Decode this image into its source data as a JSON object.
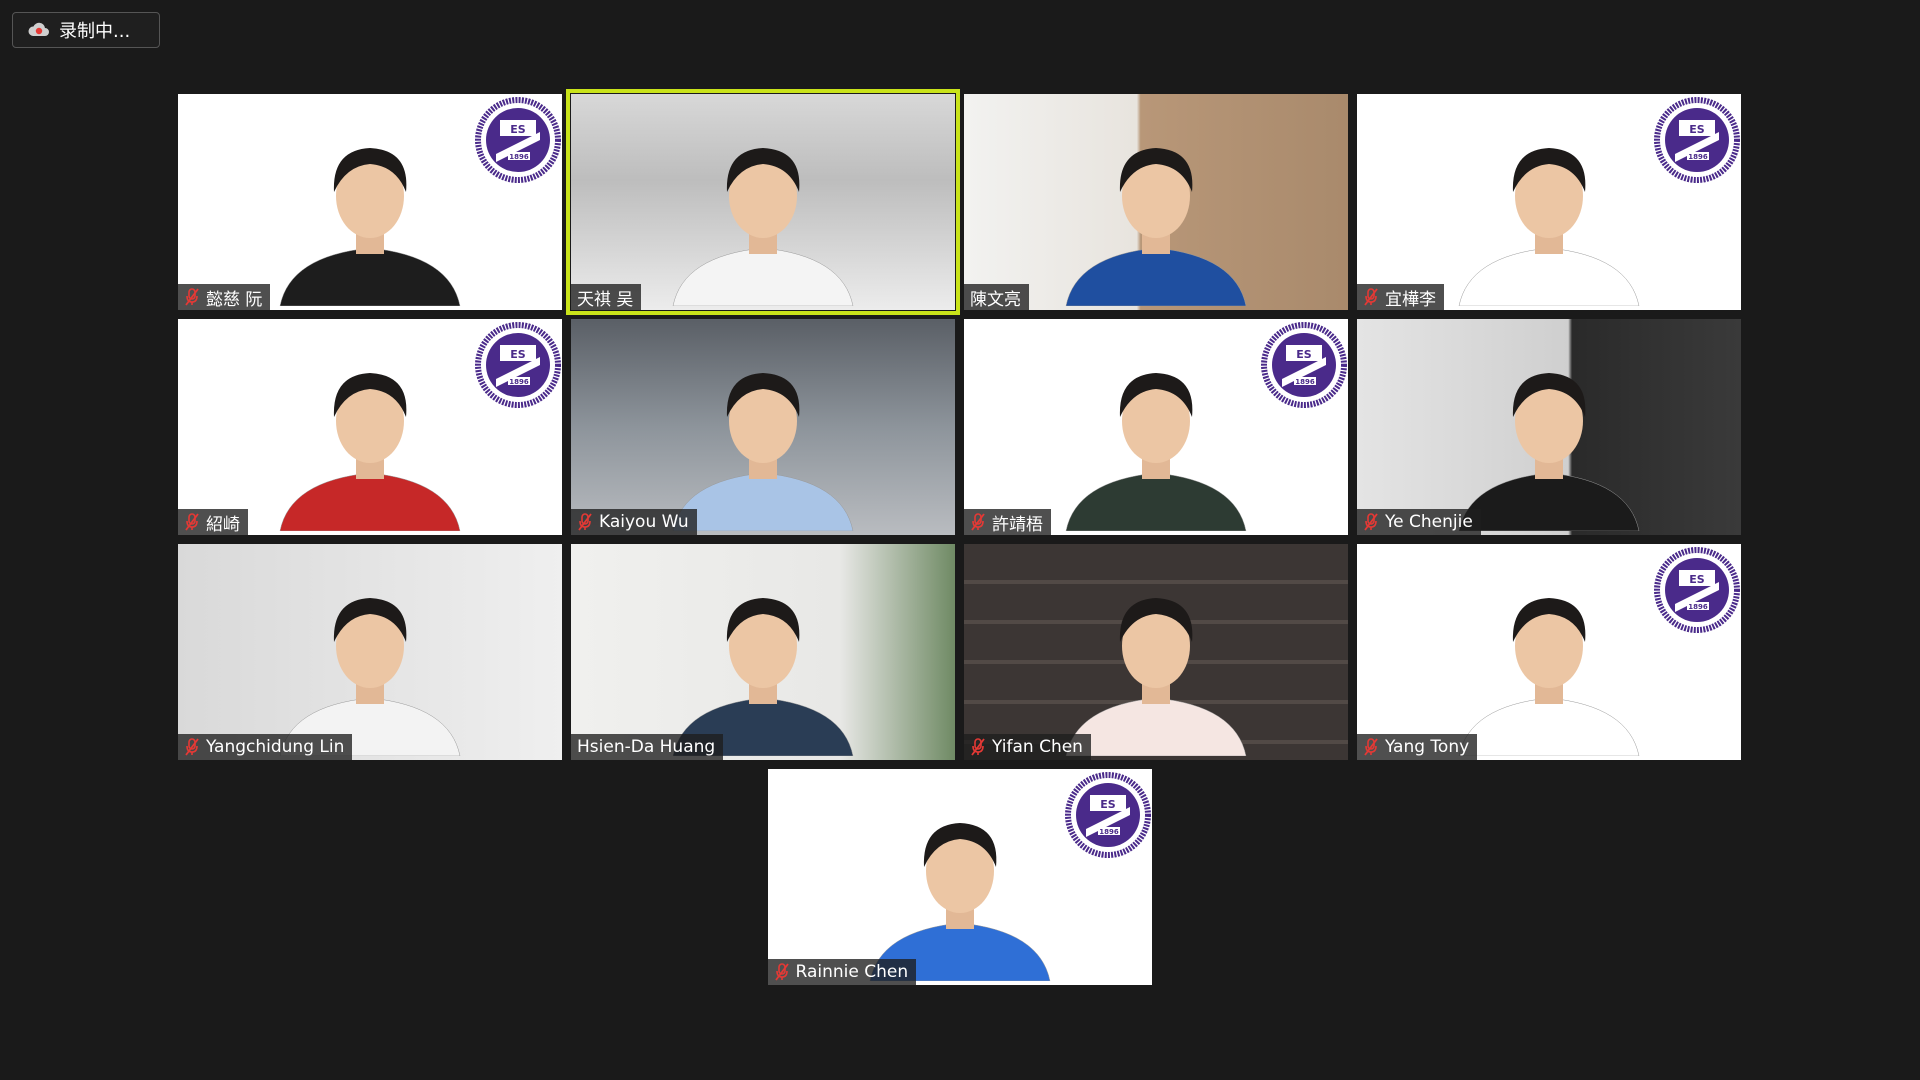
{
  "recording": {
    "label": "录制中..."
  },
  "participants": [
    {
      "name": "懿慈 阮",
      "muted": true,
      "bg": "white",
      "logo": true,
      "shirt": "#1d1d1d"
    },
    {
      "name": "天祺 吴",
      "muted": false,
      "bg": "room",
      "logo": false,
      "shirt": "#f4f4f4",
      "active": true
    },
    {
      "name": "陳文亮",
      "muted": false,
      "bg": "office",
      "logo": false,
      "shirt": "#1f4fa0"
    },
    {
      "name": "宜樺李",
      "muted": true,
      "bg": "white",
      "logo": true,
      "shirt": "#ffffff"
    },
    {
      "name": "紹崎",
      "muted": true,
      "bg": "white",
      "logo": true,
      "shirt": "#c62828"
    },
    {
      "name": "Kaiyou Wu",
      "muted": true,
      "bg": "ceiling",
      "logo": false,
      "shirt": "#a9c4e6"
    },
    {
      "name": "許靖梧",
      "muted": true,
      "bg": "white",
      "logo": true,
      "shirt": "#2d3b33"
    },
    {
      "name": "Ye Chenjie",
      "muted": true,
      "bg": "wall",
      "logo": false,
      "shirt": "#1b1b1b"
    },
    {
      "name": "Yangchidung Lin",
      "muted": true,
      "bg": "plain",
      "logo": false,
      "shirt": "#f3f3f3"
    },
    {
      "name": "Hsien-Da Huang",
      "muted": false,
      "bg": "green",
      "logo": false,
      "shirt": "#2a3d55"
    },
    {
      "name": "Yifan Chen",
      "muted": true,
      "bg": "shelf",
      "logo": false,
      "shirt": "#f5e6e2"
    },
    {
      "name": "Yang Tony",
      "muted": true,
      "bg": "white",
      "logo": true,
      "shirt": "#ffffff"
    },
    {
      "name": "Rainnie Chen",
      "muted": true,
      "bg": "white",
      "logo": true,
      "shirt": "#2f6fd6"
    }
  ],
  "logo_text": {
    "top": "ES",
    "year": "1896"
  },
  "colors": {
    "active_border": "#c9e31a",
    "muted_icon": "#e53935",
    "logo_purple": "#4a2a8a"
  },
  "icons": {
    "recording": "cloud-record-icon",
    "mute": "mic-off-icon",
    "logo": "university-seal-icon"
  }
}
